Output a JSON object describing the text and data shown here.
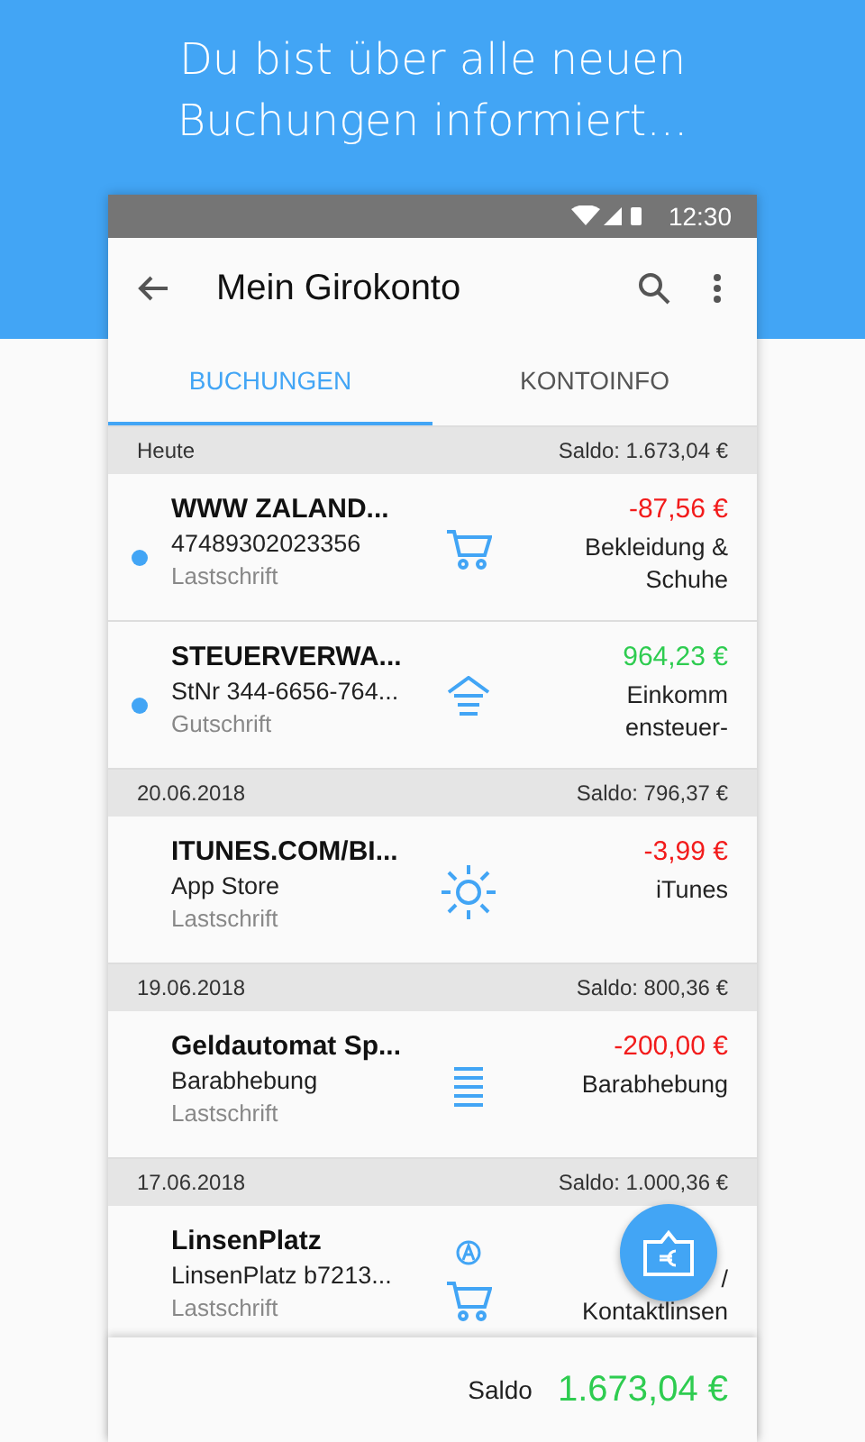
{
  "headline": [
    "Du bist über alle neuen",
    "Buchungen informiert..."
  ],
  "status_bar": {
    "time": "12:30"
  },
  "app_bar": {
    "title": "Mein Girokonto"
  },
  "tabs": [
    {
      "label": "BUCHUNGEN",
      "selected": true
    },
    {
      "label": "KONTOINFO",
      "selected": false
    }
  ],
  "groups": [
    {
      "date": "Heute",
      "balance": "Saldo: 1.673,04 €",
      "transactions": [
        {
          "name": "WWW ZALAND...",
          "detail": "47489302023356",
          "type": "Lastschrift",
          "unread": true,
          "credit": false,
          "kind": "cart",
          "amount": "-87,56 €",
          "category": [
            "Bekleidung &",
            "Schuhe"
          ]
        },
        {
          "name": "STEUERVERWA...",
          "detail": "StNr 344-6656-764...",
          "type": "Gutschrift",
          "unread": true,
          "credit": true,
          "kind": "income",
          "amount": "964,23 €",
          "category": [
            "Einkomm",
            "ensteuer-"
          ]
        }
      ]
    },
    {
      "date": "20.06.2018",
      "balance": "Saldo: 796,37 €",
      "transactions": [
        {
          "name": "ITUNES.COM/BI...",
          "detail": "App Store",
          "type": "Lastschrift",
          "unread": false,
          "credit": false,
          "kind": "sun",
          "amount": "-3,99 €",
          "category": [
            "iTunes"
          ]
        }
      ]
    },
    {
      "date": "19.06.2018",
      "balance": "Saldo: 800,36 €",
      "transactions": [
        {
          "name": "Geldautomat Sp...",
          "detail": "Barabhebung",
          "type": "Lastschrift",
          "unread": false,
          "credit": false,
          "kind": "cash",
          "amount": "-200,00 €",
          "category": [
            "Barabhebung"
          ]
        }
      ]
    },
    {
      "date": "17.06.2018",
      "balance": "Saldo: 1.000,36 €",
      "transactions": [
        {
          "name": "LinsenPlatz",
          "detail": "LinsenPlatz b7213...",
          "type": "Lastschrift",
          "unread": false,
          "kind": "cart",
          "badge": true,
          "category": [
            "/",
            "Kontaktlinsen"
          ]
        }
      ]
    }
  ],
  "footer": {
    "label": "Saldo",
    "balance": "1.673,04 €"
  }
}
